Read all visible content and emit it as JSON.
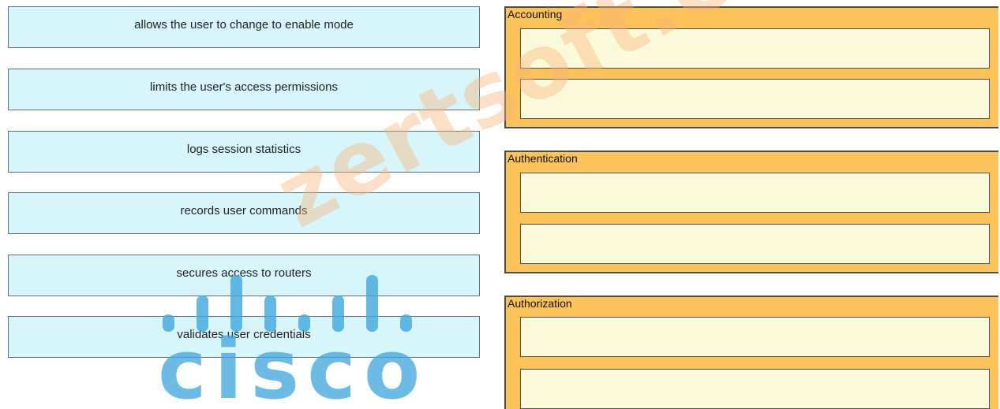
{
  "source_items": [
    {
      "label": "allows the user to change to enable mode"
    },
    {
      "label": "limits the user's access permissions"
    },
    {
      "label": "logs session statistics"
    },
    {
      "label": "records user commands"
    },
    {
      "label": "secures access to routers"
    },
    {
      "label": "validates user credentials"
    }
  ],
  "targets": [
    {
      "label": "Accounting"
    },
    {
      "label": "Authentication"
    },
    {
      "label": "Authorization"
    }
  ],
  "watermark": {
    "text": "zertsoft.com",
    "logo_text": "cisco",
    "logo_color": "#44a8de"
  },
  "colors": {
    "source_fill": "#d6f6fb",
    "group_fill": "#fbc35a",
    "slot_fill": "#fbfbdc"
  }
}
